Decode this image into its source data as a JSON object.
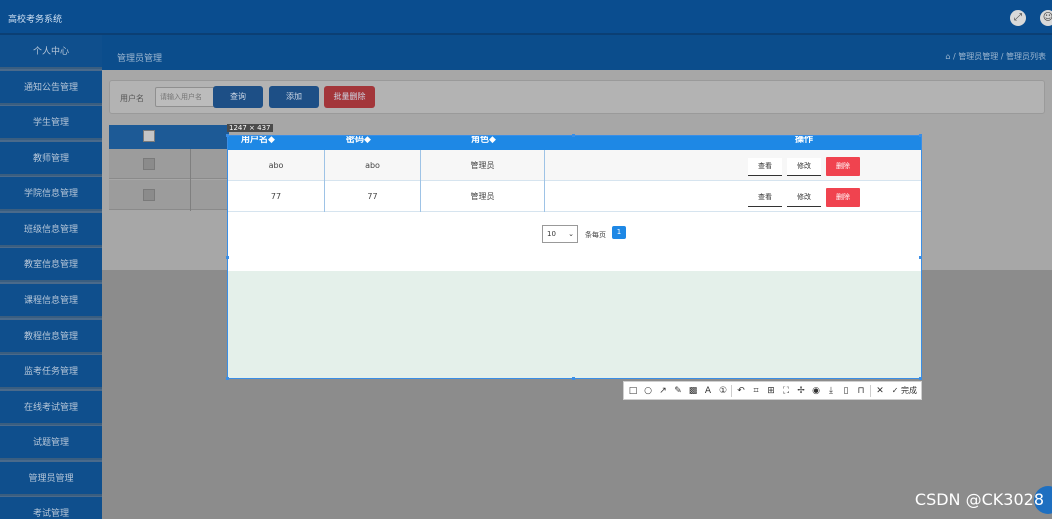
{
  "header": {
    "title": "高校考务系统"
  },
  "sidebar": {
    "items": [
      {
        "label": "个人中心"
      },
      {
        "label": "通知公告管理"
      },
      {
        "label": "学生管理"
      },
      {
        "label": "教师管理"
      },
      {
        "label": "学院信息管理"
      },
      {
        "label": "班级信息管理"
      },
      {
        "label": "教室信息管理"
      },
      {
        "label": "课程信息管理"
      },
      {
        "label": "教程信息管理"
      },
      {
        "label": "监考任务管理"
      },
      {
        "label": "在线考试管理"
      },
      {
        "label": "试题管理"
      },
      {
        "label": "管理员管理"
      },
      {
        "label": "考试管理"
      }
    ]
  },
  "breadcrumb": {
    "title": "管理员管理",
    "path": "⌂ / 管理员管理 / 管理员列表"
  },
  "search": {
    "label": "用户名",
    "placeholder": "请输入用户名",
    "query_label": "查询",
    "add_label": "添加",
    "batch_delete_label": "批量删除"
  },
  "selection": {
    "size_label": "1247 × 437"
  },
  "table": {
    "headers": [
      "用户名◆",
      "密码◆",
      "角色◆",
      "操作"
    ],
    "rows": [
      {
        "username": "abo",
        "password": "abo",
        "role": "管理员"
      },
      {
        "username": "77",
        "password": "77",
        "role": "管理员"
      }
    ],
    "view_label": "查看",
    "edit_label": "修改",
    "delete_label": "删除"
  },
  "pager": {
    "page_size": "10",
    "per_page_text": "条每页",
    "current_page": "1"
  },
  "toolbar": {
    "done_label": "完成"
  },
  "watermark": "CSDN @CK3028"
}
